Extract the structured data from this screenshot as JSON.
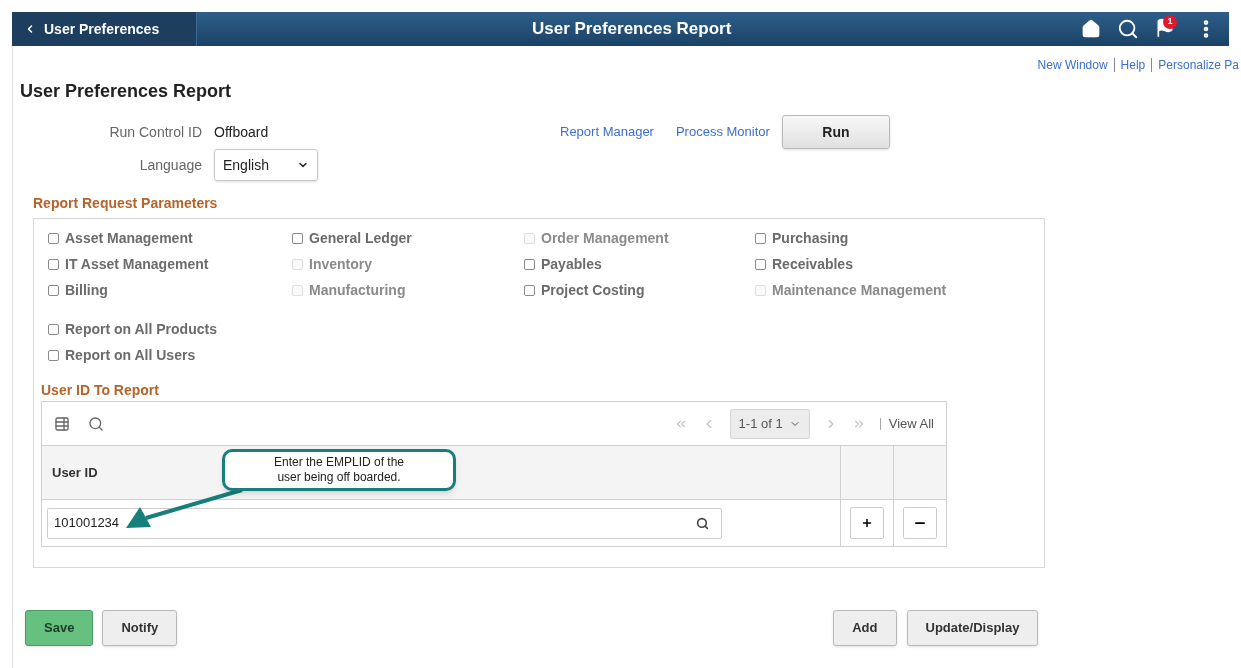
{
  "header": {
    "back_label": "User Preferences",
    "title": "User Preferences Report",
    "notification_count": "1"
  },
  "top_links": [
    "New Window",
    "Help",
    "Personalize Pa"
  ],
  "page_title": "User Preferences Report",
  "run_control": {
    "label": "Run Control ID",
    "value": "Offboard"
  },
  "language": {
    "label": "Language",
    "value": "English"
  },
  "actions": {
    "links": [
      "Report Manager",
      "Process Monitor"
    ],
    "run_button": "Run"
  },
  "parameters": {
    "title": "Report Request Parameters",
    "products": [
      {
        "label": "Asset Management",
        "checked": false,
        "disabled": false
      },
      {
        "label": "General Ledger",
        "checked": false,
        "disabled": false
      },
      {
        "label": "Order Management",
        "checked": false,
        "disabled": true
      },
      {
        "label": "Purchasing",
        "checked": false,
        "disabled": false
      },
      {
        "label": "IT Asset Management",
        "checked": false,
        "disabled": false
      },
      {
        "label": "Inventory",
        "checked": false,
        "disabled": true
      },
      {
        "label": "Payables",
        "checked": false,
        "disabled": false
      },
      {
        "label": "Receivables",
        "checked": false,
        "disabled": false
      },
      {
        "label": "Billing",
        "checked": false,
        "disabled": false
      },
      {
        "label": "Manufacturing",
        "checked": false,
        "disabled": true
      },
      {
        "label": "Project Costing",
        "checked": false,
        "disabled": false
      },
      {
        "label": "Maintenance Management",
        "checked": false,
        "disabled": true
      }
    ],
    "options": [
      {
        "label": "Report on All Products",
        "checked": false,
        "disabled": false
      },
      {
        "label": "Report on All Users",
        "checked": false,
        "disabled": false
      }
    ]
  },
  "user_grid": {
    "title": "User ID To Report",
    "pagination": "1-1 of 1",
    "view_all": "View All",
    "column": "User ID",
    "rows": [
      {
        "user_id": "101001234"
      }
    ]
  },
  "callout": "Enter the EMPLID of the user being off boarded.",
  "footer_buttons": [
    {
      "label": "Save",
      "kind": "primary"
    },
    {
      "label": "Notify",
      "kind": "normal"
    },
    {
      "label": "Add",
      "kind": "normal"
    },
    {
      "label": "Update/Display",
      "kind": "normal"
    }
  ]
}
